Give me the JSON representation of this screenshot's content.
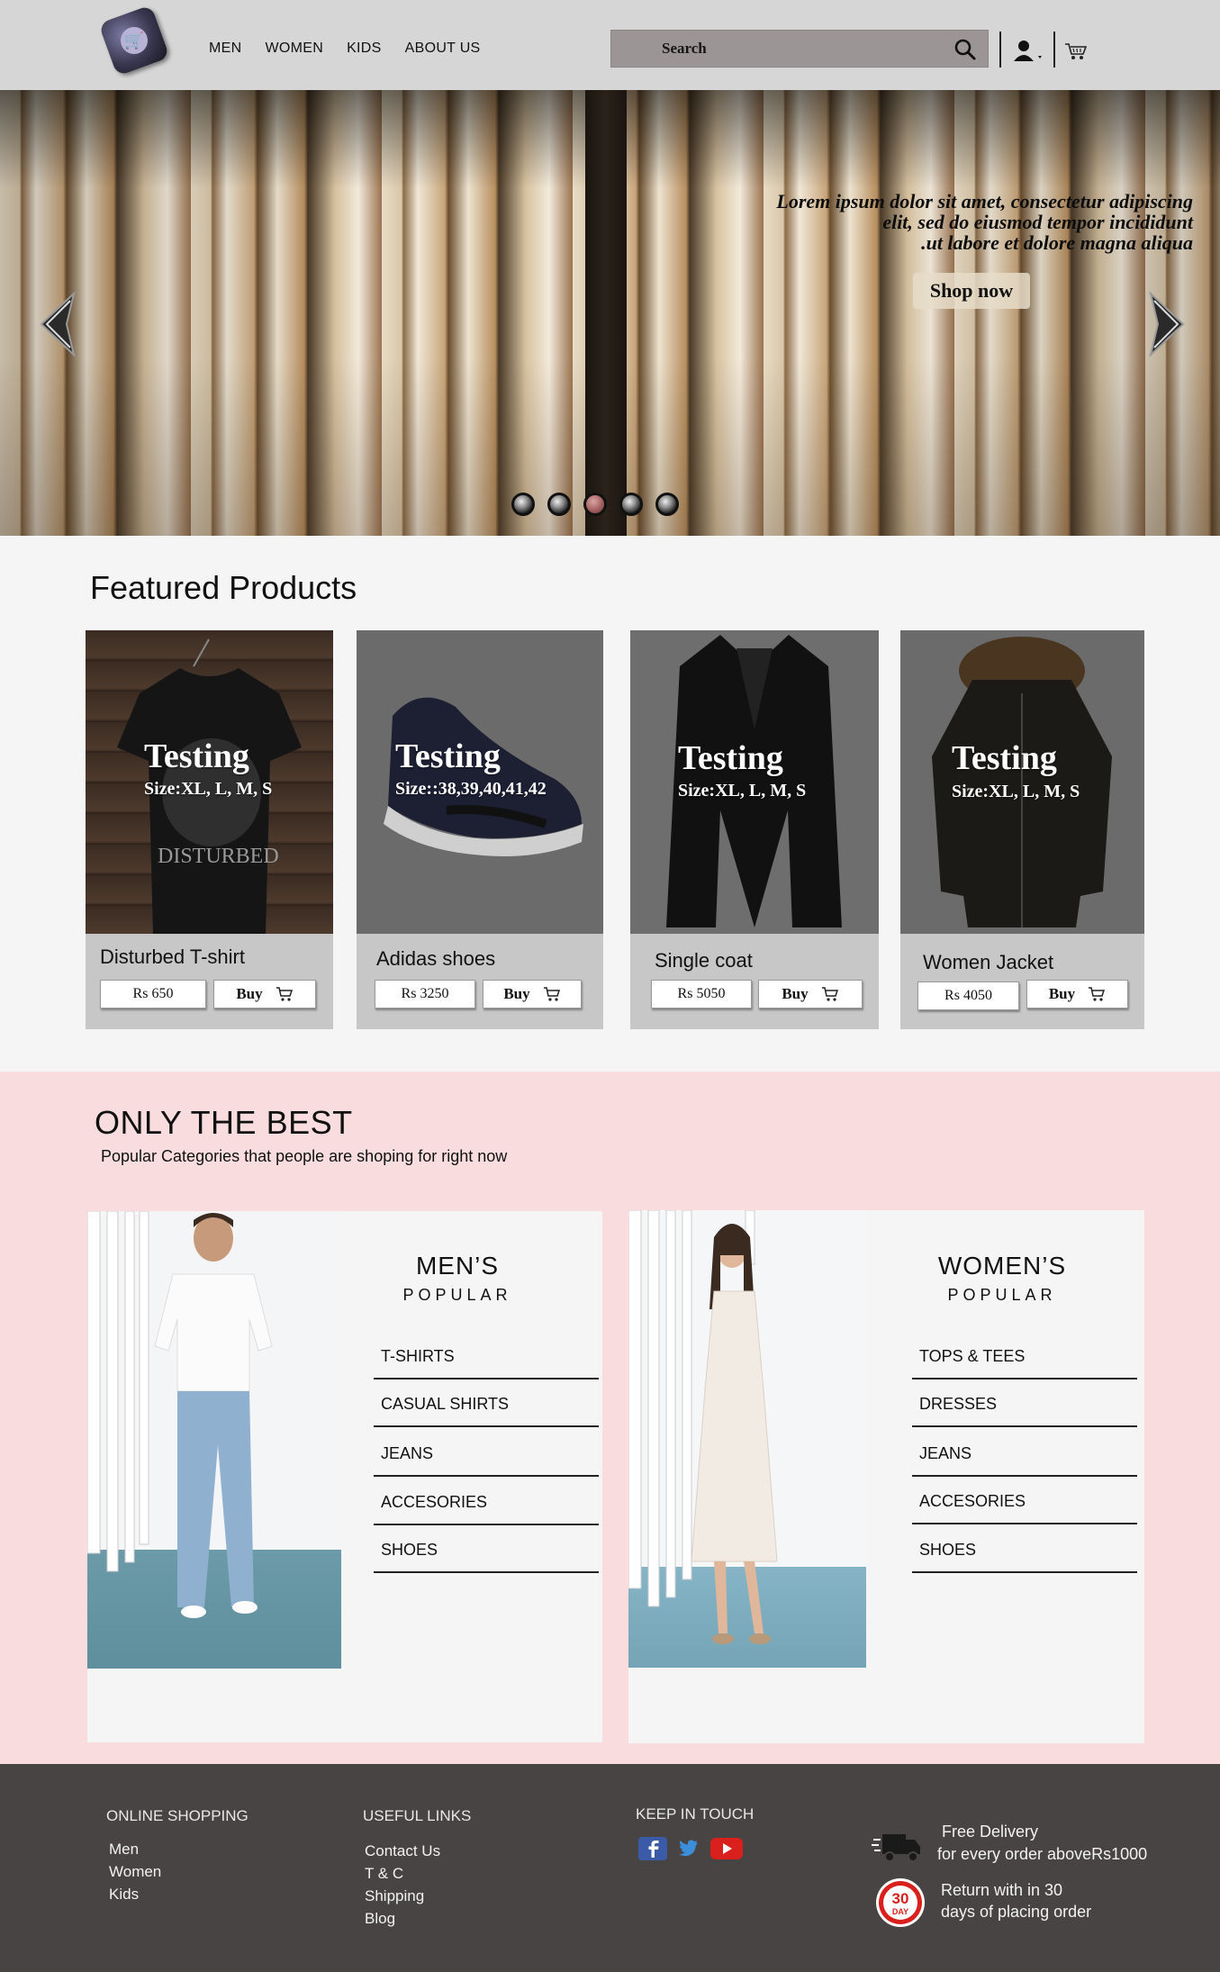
{
  "header": {
    "nav": [
      "MEN",
      "WOMEN",
      "KIDS",
      "ABOUT US"
    ],
    "search_placeholder": "Search"
  },
  "hero": {
    "caption_line1": "Lorem ipsum dolor sit amet, consectetur adipiscing",
    "caption_line2": "elit, sed do eiusmod tempor incididunt",
    "caption_line3": ".ut labore et dolore magna aliqua",
    "cta": "Shop now",
    "slides": 5,
    "active_slide": 3
  },
  "featured": {
    "title": "Featured Products",
    "products": [
      {
        "overlay_title": "Testing",
        "overlay_size": "Size:XL, L, M, S",
        "name": "Disturbed T-shirt",
        "price": "Rs 650",
        "buy": "Buy"
      },
      {
        "overlay_title": "Testing",
        "overlay_size": "Size::38,39,40,41,42",
        "name": "Adidas shoes",
        "price": "Rs 3250",
        "buy": "Buy"
      },
      {
        "overlay_title": "Testing",
        "overlay_size": "Size:XL, L, M, S",
        "name": "Single coat",
        "price": "Rs 5050",
        "buy": "Buy"
      },
      {
        "overlay_title": "Testing",
        "overlay_size": "Size:XL, L, M, S",
        "name": "Women Jacket",
        "price": "Rs 4050",
        "buy": "Buy"
      }
    ]
  },
  "best": {
    "title": "ONLY THE BEST",
    "subtitle": "Popular Categories that people are shoping for right now",
    "mens": {
      "heading": "MEN’S",
      "subheading": "POPULAR",
      "items": [
        "T-SHIRTS",
        "CASUAL SHIRTS",
        "JEANS",
        "ACCESORIES",
        "SHOES"
      ]
    },
    "womens": {
      "heading": "WOMEN’S",
      "subheading": "POPULAR",
      "items": [
        "TOPS & TEES",
        "DRESSES",
        "JEANS",
        "ACCESORIES",
        "SHOES"
      ]
    }
  },
  "footer": {
    "online_shopping": {
      "heading": "ONLINE SHOPPING",
      "links": [
        "Men",
        "Women",
        "Kids"
      ]
    },
    "useful_links": {
      "heading": "USEFUL LINKS",
      "links": [
        "Contact Us",
        "T & C",
        "Shipping",
        "Blog"
      ]
    },
    "keep_in_touch": {
      "heading": "KEEP IN TOUCH"
    },
    "delivery": {
      "line1": "Free Delivery",
      "line2": "for every order aboveRs1000"
    },
    "returns": {
      "badge_number": "30",
      "badge_word": "DAY",
      "line1": "Return with in 30",
      "line2": "days of placing order"
    }
  },
  "colors": {
    "header_bg": "#d6d6d6",
    "search_bg": "#9b9595",
    "best_bg": "#f8dcde",
    "footer_bg": "#474443",
    "card_bg": "#c7c7c7"
  }
}
